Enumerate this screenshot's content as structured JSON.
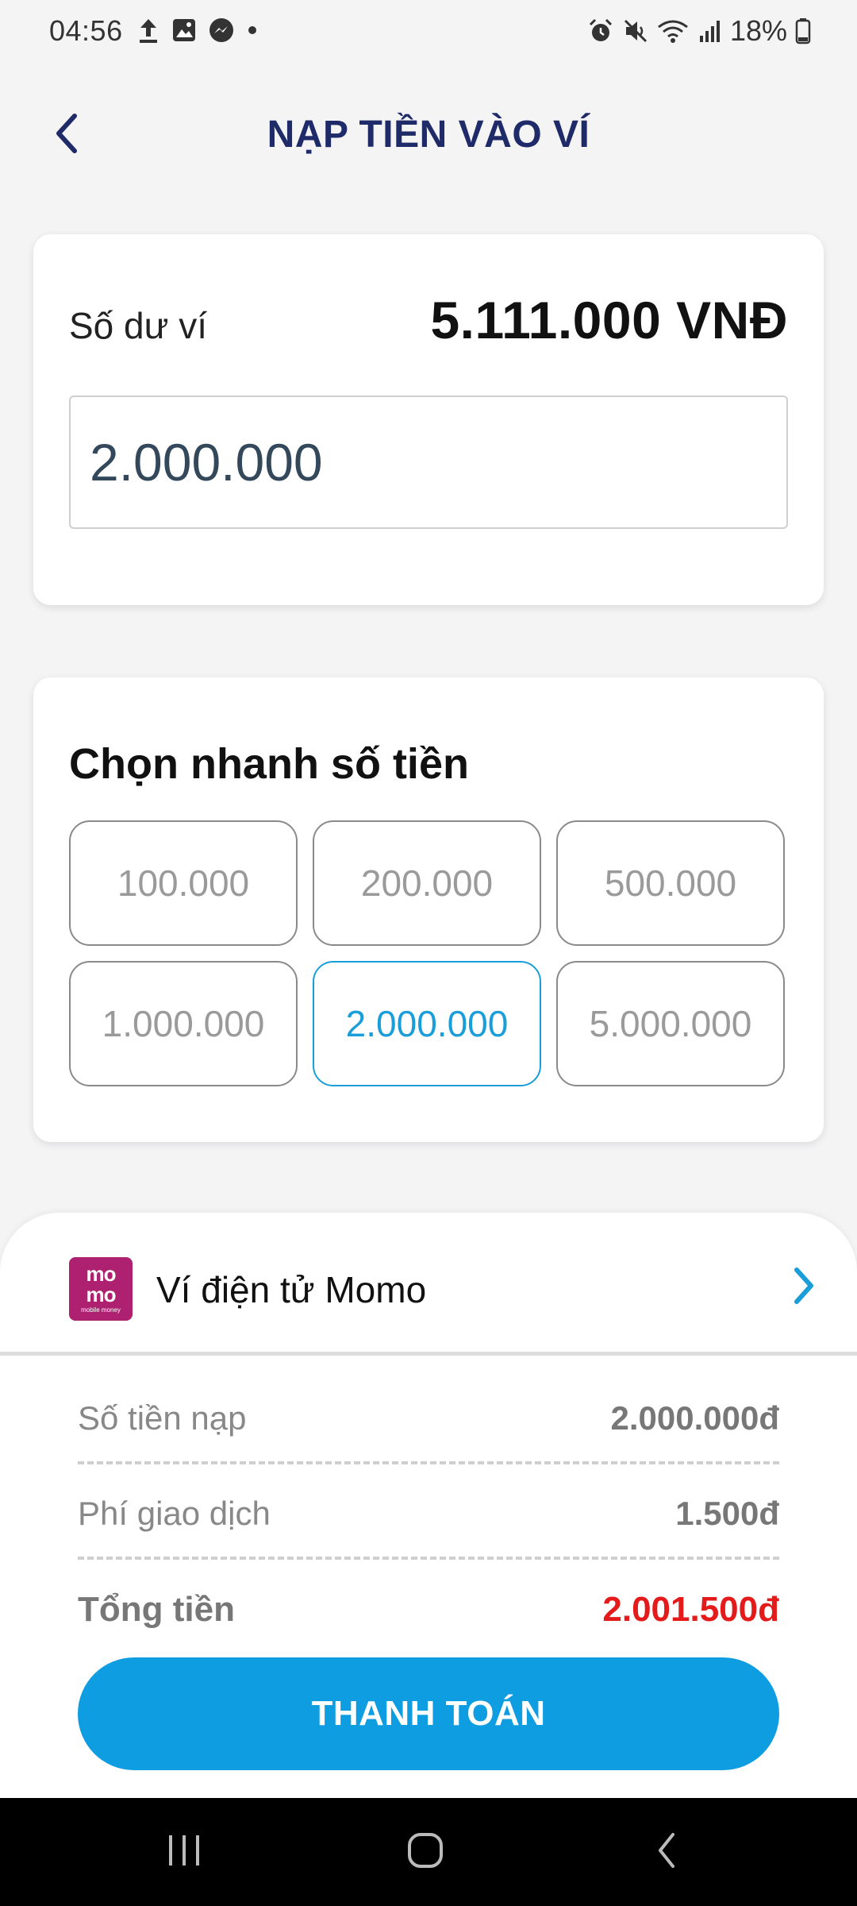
{
  "status_bar": {
    "time": "04:56",
    "battery": "18%",
    "left_icons": [
      "upload-icon",
      "gallery-icon",
      "messenger-icon",
      "dot-icon"
    ],
    "right_icons": [
      "alarm-icon",
      "mute-icon",
      "wifi-icon",
      "signal-icon",
      "battery-icon"
    ]
  },
  "header": {
    "title": "NẠP TIỀN VÀO VÍ",
    "back_icon": "chevron-left-icon"
  },
  "balance": {
    "label": "Số dư ví",
    "value": "5.111.000 VNĐ",
    "amount_input": "2.000.000"
  },
  "quick_select": {
    "title": "Chọn nhanh số tiền",
    "options": [
      "100.000",
      "200.000",
      "500.000",
      "1.000.000",
      "2.000.000",
      "5.000.000"
    ],
    "selected": "2.000.000"
  },
  "payment_method": {
    "logo_text": "mo mo",
    "logo_subtext": "mobile money",
    "name": "Ví điện tử Momo",
    "chevron_icon": "chevron-right-icon"
  },
  "summary": {
    "deposit_label": "Số tiền nạp",
    "deposit_value": "2.000.000đ",
    "fee_label": "Phí giao dịch",
    "fee_value": "1.500đ",
    "total_label": "Tổng tiền",
    "total_value": "2.001.500đ"
  },
  "pay_button": "THANH TOÁN",
  "colors": {
    "title_navy": "#1f2a68",
    "accent_blue": "#0f9de2",
    "total_red": "#e51b1b",
    "momo_pink": "#ae2070"
  },
  "nav_bar": [
    "recents-icon",
    "home-icon",
    "back-icon"
  ]
}
